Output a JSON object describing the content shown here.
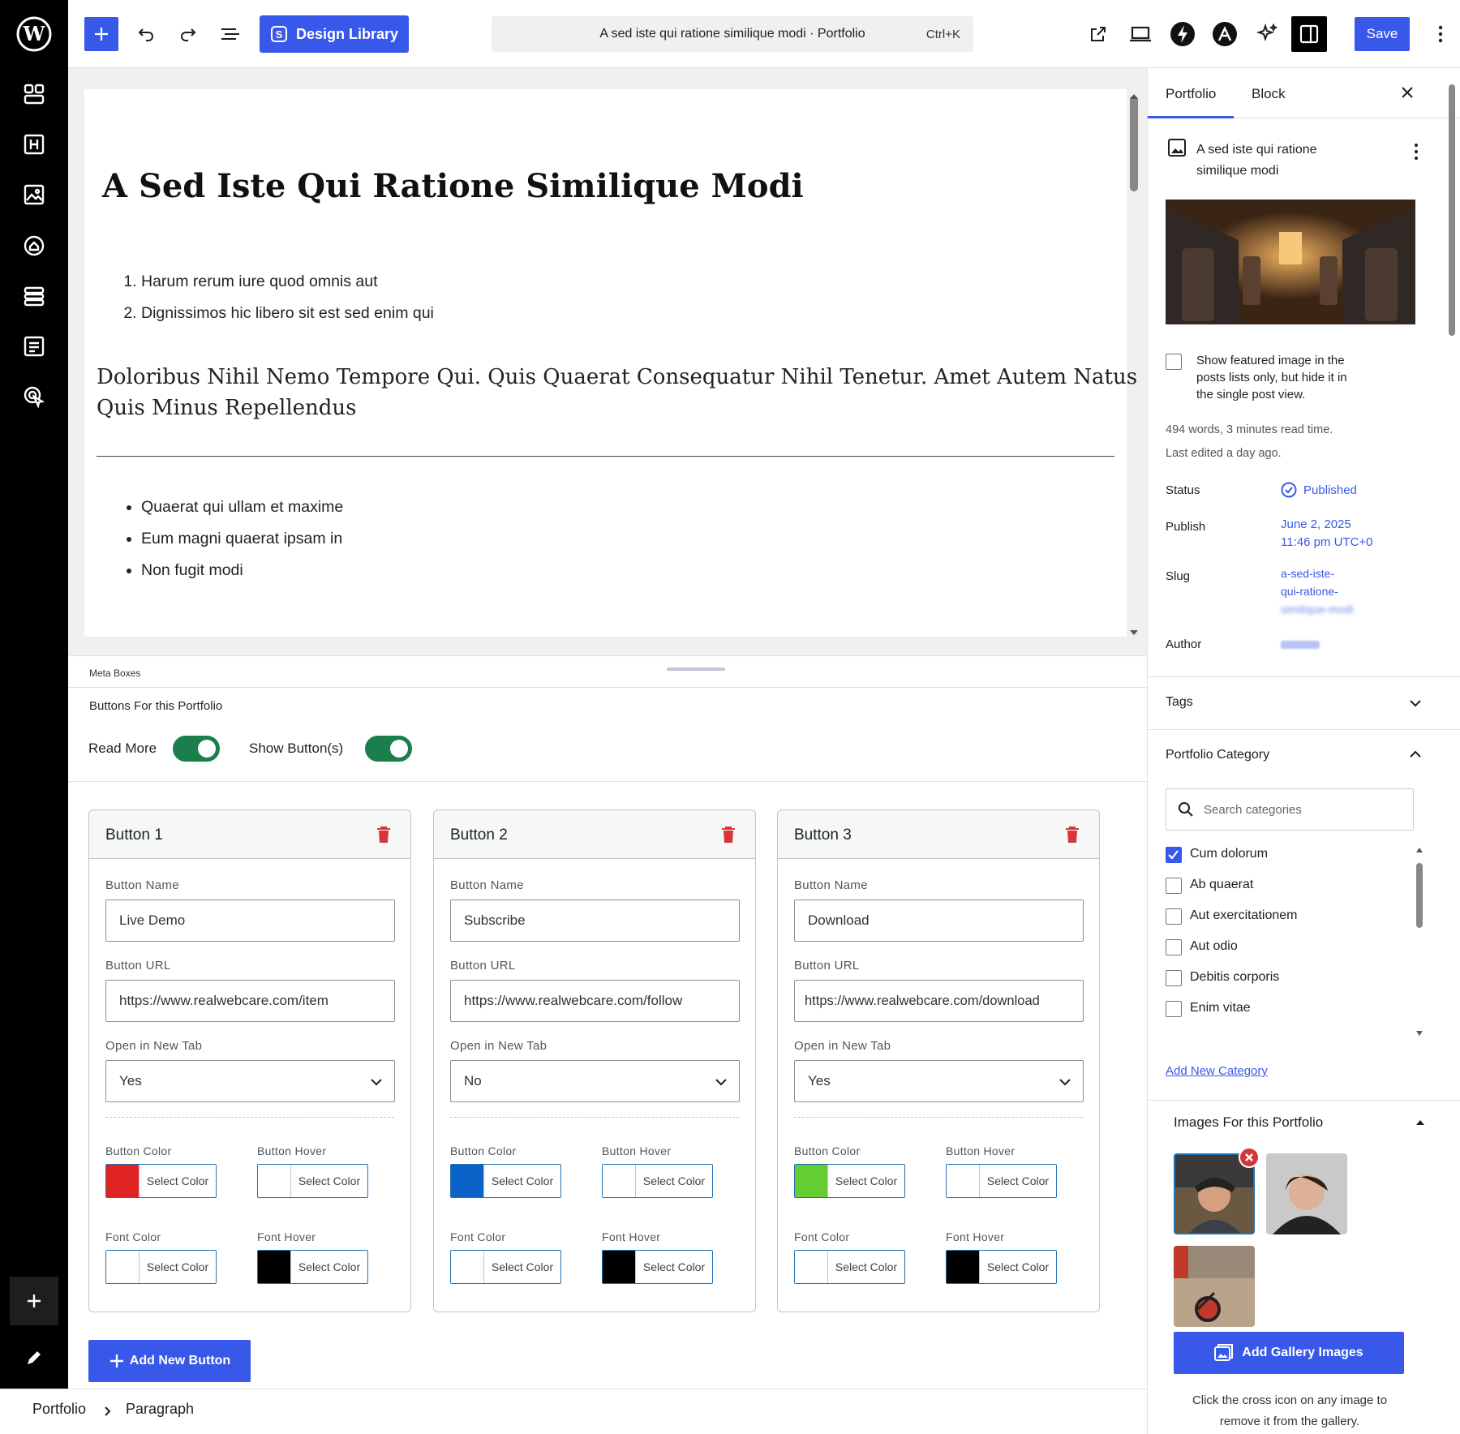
{
  "topbar": {
    "design_library_label": "Design Library",
    "command_title": "A sed iste qui ratione similique modi · Portfolio",
    "command_shortcut": "Ctrl+K",
    "save_label": "Save"
  },
  "editor": {
    "title": "A Sed Iste Qui Ratione Similique Modi",
    "ordered_list": [
      "Harum rerum iure quod omnis aut",
      "Dignissimos hic libero sit est sed enim qui"
    ],
    "heading_line1": "Doloribus Nihil Nemo Tempore Qui. Quis Quaerat Consequatur Nihil Tenetur. Amet Autem Natus",
    "heading_line2": "Quis Minus Repellendus",
    "bullet_list": [
      "Quaerat qui ullam et maxime",
      "Eum magni quaerat ipsam in",
      "Non fugit modi"
    ]
  },
  "metabox": {
    "section_label": "Meta Boxes",
    "heading": "Buttons For this Portfolio",
    "toggles": [
      {
        "label": "Read More",
        "on": true
      },
      {
        "label": "Show Button(s)",
        "on": true
      }
    ],
    "field_labels": {
      "name": "Button Name",
      "url": "Button URL",
      "new_tab": "Open in New Tab",
      "button_color": "Button Color",
      "button_hover": "Button Hover",
      "font_color": "Font Color",
      "font_hover": "Font Hover"
    },
    "select_color_label": "Select Color",
    "buttons": [
      {
        "title": "Button 1",
        "name": "Live Demo",
        "url": "https://www.realwebcare.com/item",
        "new_tab": "Yes",
        "button_color": "#e02424",
        "button_hover": "#ffffff",
        "font_color": "#ffffff",
        "font_hover": "#000000"
      },
      {
        "title": "Button 2",
        "name": "Subscribe",
        "url": "https://www.realwebcare.com/follow",
        "new_tab": "No",
        "button_color": "#0a62c9",
        "button_hover": "#ffffff",
        "font_color": "#ffffff",
        "font_hover": "#000000"
      },
      {
        "title": "Button 3",
        "name": "Download",
        "url": "https://www.realwebcare.com/download",
        "new_tab": "Yes",
        "button_color": "#66cc33",
        "button_hover": "#ffffff",
        "font_color": "#ffffff",
        "font_hover": "#000000"
      }
    ],
    "add_button_label": "Add New Button"
  },
  "sidebar": {
    "tabs": [
      "Portfolio",
      "Block"
    ],
    "post_title_line1": "A sed iste qui ratione",
    "post_title_line2": "similique modi",
    "featured_checkbox_label": [
      "Show featured image in the",
      "posts lists only, but hide it in",
      "the single post view."
    ],
    "word_count": "494 words, 3 minutes read time.",
    "last_edited": "Last edited a day ago.",
    "status_label": "Status",
    "status_value": "Published",
    "publish_label": "Publish",
    "publish_value_line1": "June 2, 2025",
    "publish_value_line2": "11:46 pm UTC+0",
    "slug_label": "Slug",
    "slug_value_line1": "a-sed-iste-",
    "slug_value_line2": "qui-ratione-",
    "slug_value_line3": "similique-modi",
    "author_label": "Author",
    "tags_label": "Tags",
    "category_label": "Portfolio Category",
    "search_placeholder": "Search categories",
    "categories": [
      {
        "label": "Cum dolorum",
        "checked": true
      },
      {
        "label": "Ab quaerat",
        "checked": false
      },
      {
        "label": "Aut exercitationem",
        "checked": false
      },
      {
        "label": "Aut odio",
        "checked": false
      },
      {
        "label": "Debitis corporis",
        "checked": false
      },
      {
        "label": "Enim vitae",
        "checked": false
      }
    ],
    "add_category_label": "Add New Category",
    "images_heading": "Images For this Portfolio",
    "add_gallery_label": "Add Gallery Images",
    "gallery_hint_line1": "Click the cross icon on any image to",
    "gallery_hint_line2": "remove it from the gallery."
  },
  "breadcrumb": [
    "Portfolio",
    "Paragraph"
  ],
  "colors": {
    "accent": "#3858e9",
    "toggle_on": "#1a7f4b",
    "delete": "#d63638"
  }
}
